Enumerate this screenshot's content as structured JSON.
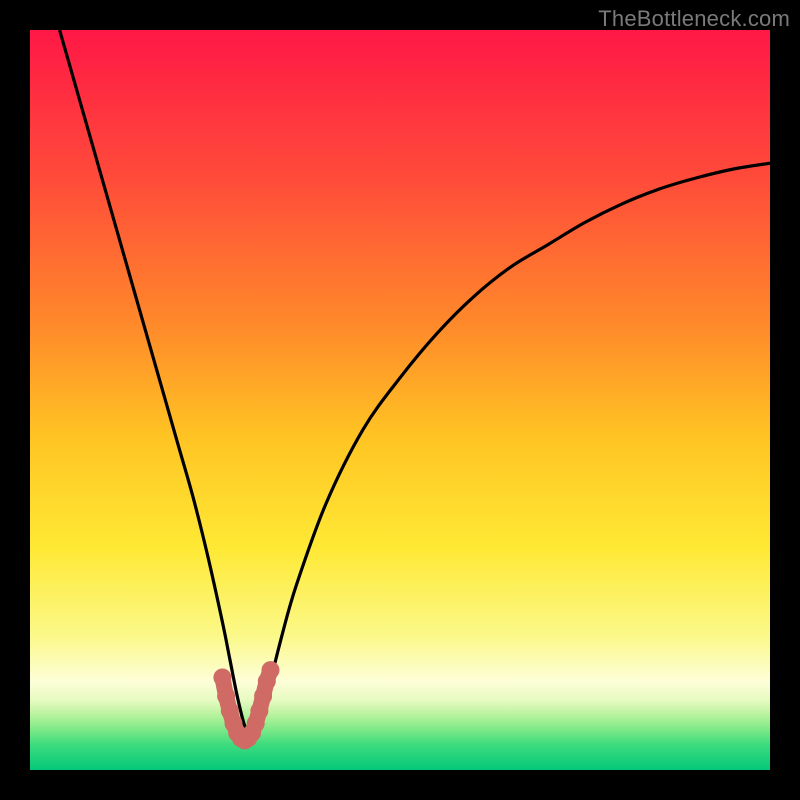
{
  "watermark": "TheBottleneck.com",
  "colors": {
    "frame": "#000000",
    "curve": "#000000",
    "overlay": "#cf6a64",
    "gradient_stops": [
      {
        "offset": 0.0,
        "color": "#ff1846"
      },
      {
        "offset": 0.2,
        "color": "#ff4b3a"
      },
      {
        "offset": 0.4,
        "color": "#ff8a2a"
      },
      {
        "offset": 0.55,
        "color": "#ffc423"
      },
      {
        "offset": 0.7,
        "color": "#ffe935"
      },
      {
        "offset": 0.82,
        "color": "#fbf98a"
      },
      {
        "offset": 0.88,
        "color": "#fdfed8"
      },
      {
        "offset": 0.905,
        "color": "#e8fbc2"
      },
      {
        "offset": 0.925,
        "color": "#b9f39e"
      },
      {
        "offset": 0.945,
        "color": "#7fe988"
      },
      {
        "offset": 0.965,
        "color": "#3edc7e"
      },
      {
        "offset": 1.0,
        "color": "#05c87a"
      }
    ]
  },
  "chart_data": {
    "type": "line",
    "title": "",
    "xlabel": "",
    "ylabel": "",
    "xlim": [
      0,
      100
    ],
    "ylim": [
      0,
      100
    ],
    "series": [
      {
        "name": "bottleneck-curve",
        "x": [
          4,
          6,
          8,
          10,
          12,
          14,
          16,
          18,
          20,
          22,
          24,
          26,
          27,
          28,
          29,
          30,
          31,
          32,
          34,
          36,
          40,
          45,
          50,
          55,
          60,
          65,
          70,
          75,
          80,
          85,
          90,
          95,
          100
        ],
        "values": [
          100,
          93,
          86,
          79,
          72,
          65,
          58,
          51,
          44,
          37,
          29,
          20,
          15,
          10,
          6,
          4,
          6,
          10,
          18,
          25,
          36,
          46,
          53,
          59,
          64,
          68,
          71,
          74,
          76.5,
          78.5,
          80,
          81.2,
          82
        ]
      }
    ],
    "overlay_segment": {
      "name": "optimal-range",
      "x": [
        26.0,
        26.5,
        27.0,
        27.5,
        28.0,
        28.5,
        29.0,
        29.5,
        30.0,
        30.5,
        31.0,
        31.5,
        32.0,
        32.5
      ],
      "values": [
        12.5,
        10.0,
        8.0,
        6.3,
        5.0,
        4.3,
        4.0,
        4.3,
        5.0,
        6.3,
        8.0,
        10.0,
        12.0,
        13.5
      ]
    }
  }
}
